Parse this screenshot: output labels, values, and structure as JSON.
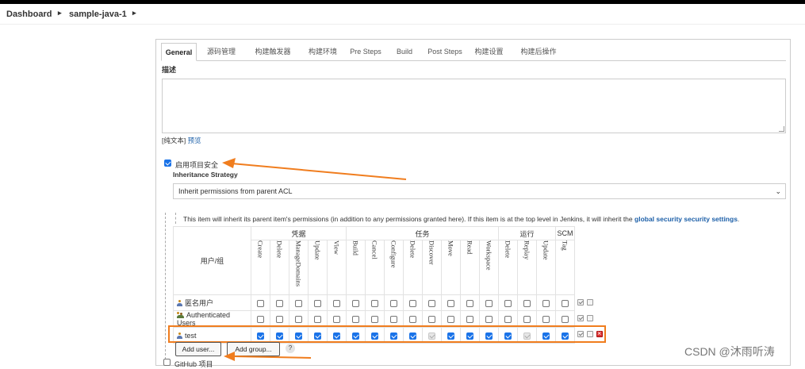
{
  "breadcrumbs": [
    "Dashboard",
    "sample-java-1"
  ],
  "tabs": [
    "General",
    "源码管理",
    "构建触发器",
    "构建环境",
    "Pre Steps",
    "Build",
    "Post Steps",
    "构建设置",
    "构建后操作"
  ],
  "description": {
    "label": "描述",
    "format_text": "[纯文本]",
    "preview_link": "预览"
  },
  "project_security": {
    "checkbox_label": "启用项目安全",
    "checked": true,
    "inheritance_label": "Inheritance Strategy",
    "inheritance_value": "Inherit permissions from parent ACL",
    "info_text": "This item will inherit its parent item's permissions (in addition to any permissions granted here). If this item is at the top level in Jenkins, it will inherit the",
    "info_link": "global security security settings",
    "info_suffix": "."
  },
  "matrix": {
    "user_group_header": "用户/组",
    "groups": [
      {
        "name": "凭据",
        "span": 5
      },
      {
        "name": "任务",
        "span": 8
      },
      {
        "name": "运行",
        "span": 3
      },
      {
        "name": "SCM",
        "span": 1
      }
    ],
    "permissions": [
      "Create",
      "Delete",
      "ManageDomains",
      "Update",
      "View",
      "Build",
      "Cancel",
      "Configure",
      "Delete",
      "Discover",
      "Move",
      "Read",
      "Workspace",
      "Delete",
      "Replay",
      "Update",
      "Tag"
    ],
    "rows": [
      {
        "name": "匿名用户",
        "icon": "user-icon",
        "values": [
          "off",
          "off",
          "off",
          "off",
          "off",
          "off",
          "off",
          "off",
          "off",
          "off",
          "off",
          "off",
          "off",
          "off",
          "off",
          "off",
          "off"
        ]
      },
      {
        "name": "Authenticated Users",
        "icon": "group-icon",
        "values": [
          "off",
          "off",
          "off",
          "off",
          "off",
          "off",
          "off",
          "off",
          "off",
          "off",
          "off",
          "off",
          "off",
          "off",
          "off",
          "off",
          "off"
        ]
      },
      {
        "name": "test",
        "icon": "user-icon",
        "values": [
          "on",
          "on",
          "on",
          "on",
          "on",
          "on",
          "on",
          "on",
          "on",
          "dis",
          "on",
          "on",
          "on",
          "on",
          "dis",
          "on",
          "on"
        ]
      }
    ]
  },
  "buttons": {
    "add_user": "Add user...",
    "add_group": "Add group...",
    "help": "?"
  },
  "github_project": {
    "label": "GitHub 项目",
    "checked": false
  },
  "watermark": "CSDN @沐雨听涛",
  "colors": {
    "accent": "#1a73e8",
    "highlight": "#f07d1e",
    "link": "#1c5fa8"
  }
}
